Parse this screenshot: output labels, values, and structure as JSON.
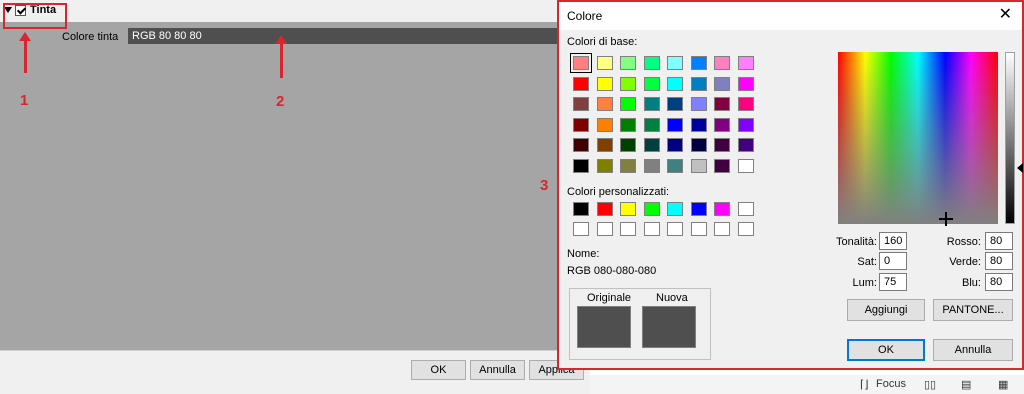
{
  "panel": {
    "section_title": "Tinta",
    "tint_color_label": "Colore tinta",
    "tint_color_value": "RGB 80 80 80",
    "tint_color_hex": "#4f4f4f",
    "buttons": {
      "ok": "OK",
      "cancel": "Annulla",
      "apply": "Applica"
    }
  },
  "annotations": {
    "one": "1",
    "two": "2",
    "three": "3",
    "color": "#d9262e"
  },
  "status_bar": {
    "focus_label": "Focus"
  },
  "dialog": {
    "title": "Colore",
    "close_glyph": "✕",
    "basic_colors_label": "Colori di base:",
    "basic_colors": [
      [
        "#ff8080",
        "#ffff80",
        "#80ff80",
        "#00ff80",
        "#80ffff",
        "#0080ff",
        "#ff80c0",
        "#ff80ff"
      ],
      [
        "#ff0000",
        "#ffff00",
        "#80ff00",
        "#00ff40",
        "#00ffff",
        "#0080c0",
        "#8080c0",
        "#ff00ff"
      ],
      [
        "#804040",
        "#ff8040",
        "#00ff00",
        "#008080",
        "#004080",
        "#8080ff",
        "#800040",
        "#ff0080"
      ],
      [
        "#800000",
        "#ff8000",
        "#008000",
        "#008040",
        "#0000ff",
        "#0000a0",
        "#800080",
        "#8000ff"
      ],
      [
        "#400000",
        "#804000",
        "#004000",
        "#004040",
        "#000080",
        "#000040",
        "#400040",
        "#400080"
      ],
      [
        "#000000",
        "#808000",
        "#808040",
        "#808080",
        "#408080",
        "#c0c0c0",
        "#400040",
        "#ffffff"
      ]
    ],
    "custom_colors_label": "Colori personalizzati:",
    "custom_colors": [
      [
        "#000000",
        "#ff0000",
        "#ffff00",
        "#00ff00",
        "#00ffff",
        "#0000ff",
        "#ff00ff",
        "#ffffff"
      ],
      [
        "#ffffff",
        "#ffffff",
        "#ffffff",
        "#ffffff",
        "#ffffff",
        "#ffffff",
        "#ffffff",
        "#ffffff"
      ]
    ],
    "name_label": "Nome:",
    "name_value": "RGB 080-080-080",
    "original_label": "Originale",
    "new_label": "Nuova",
    "original_color": "#4f4f4f",
    "new_color": "#4f4f4f",
    "hue_label": "Tonalità:",
    "hue": "160",
    "sat_label": "Sat:",
    "sat": "0",
    "lum_label": "Lum:",
    "lum": "75",
    "red_label": "Rosso:",
    "red": "80",
    "green_label": "Verde:",
    "green": "80",
    "blue_label": "Blu:",
    "blue": "80",
    "add_button": "Aggiungi",
    "pantone_button": "PANTONE...",
    "ok_button": "OK",
    "cancel_button": "Annulla"
  }
}
